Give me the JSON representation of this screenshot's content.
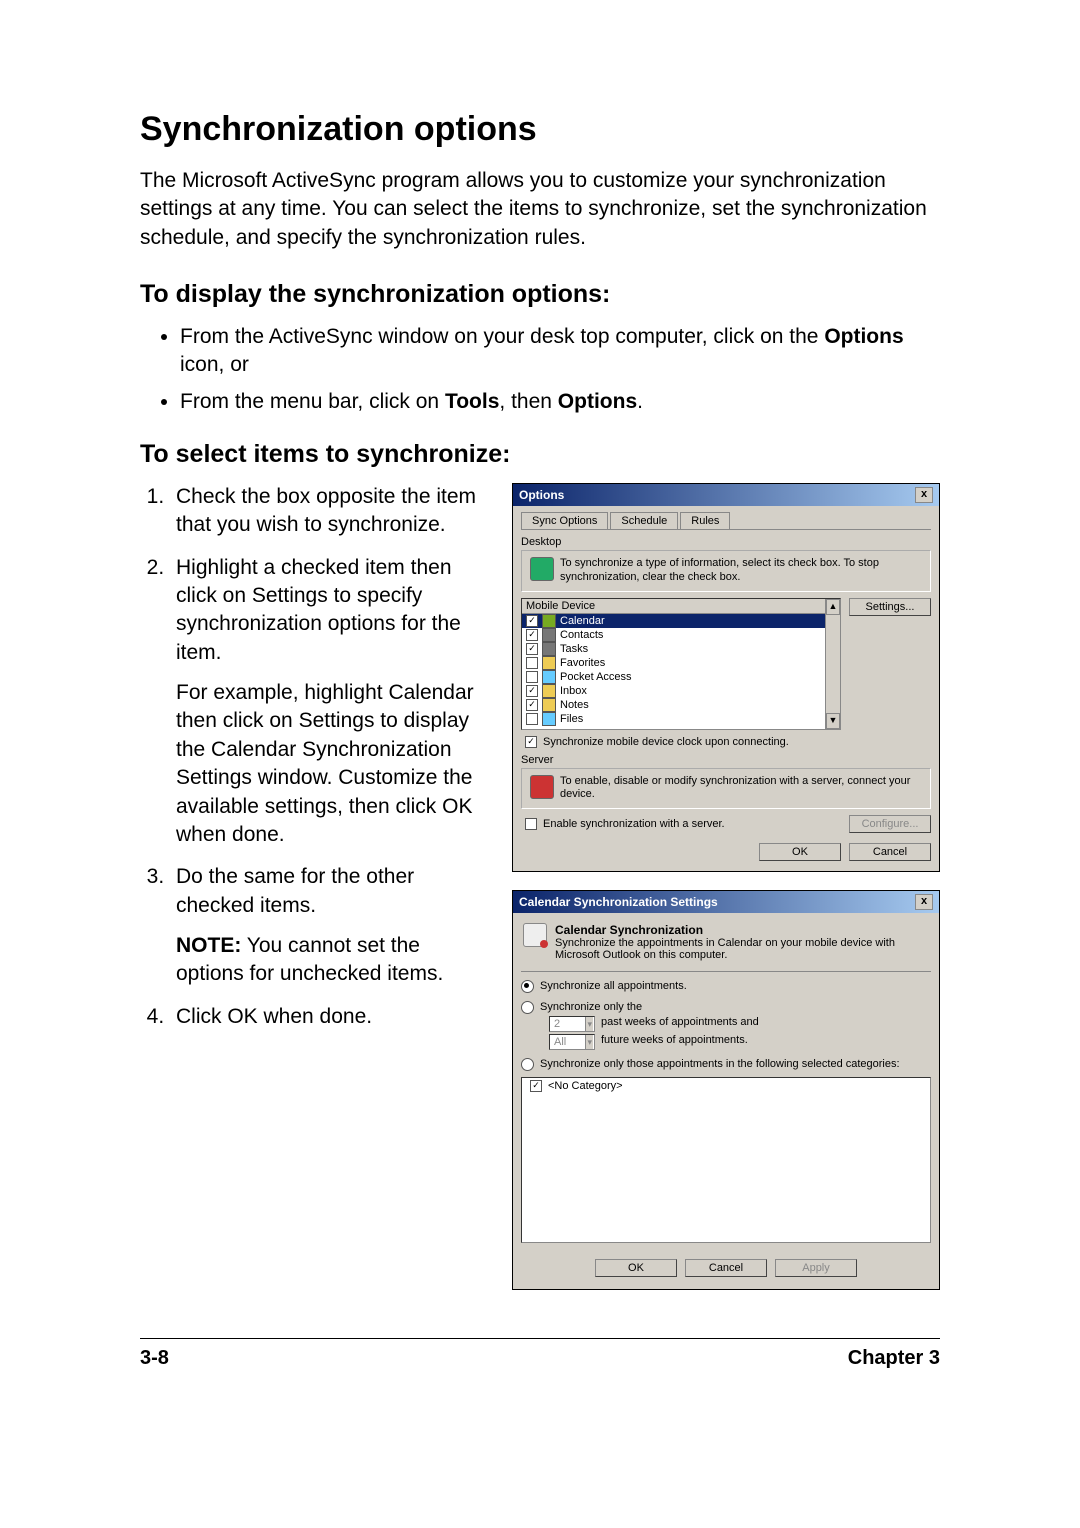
{
  "page": {
    "title": "Synchronization options",
    "intro": "The Microsoft ActiveSync program allows you to customize your synchronization settings at any time. You can select the items to synchronize, set the synchronization schedule, and specify the synchronization rules.",
    "footer_left": "3-8",
    "footer_right": "Chapter 3"
  },
  "sec_display": {
    "heading": "To display the synchronization options:",
    "b1a": "From the ActiveSync window on your desk top computer, click on the ",
    "b1b": "Options",
    "b1c": " icon, or",
    "b2a": "From the menu bar, click on ",
    "b2b": "Tools",
    "b2c": ", then ",
    "b2d": "Options",
    "b2e": "."
  },
  "sec_select": {
    "heading": "To select items to synchronize:",
    "step1": "Check the box opposite the item that you wish to synchronize.",
    "step2": "Highlight a checked item then click on Settings to specify synchronization options for the item.",
    "step2_sub": "For example, highlight Calendar then click on Settings to display the Calendar Synchronization Settings window. Customize the available settings, then click OK when done.",
    "step3": "Do the same for the other checked items.",
    "step3_note_label": "NOTE:",
    "step3_note_text": "  You cannot set the options for unchecked items.",
    "step4": "Click OK when done."
  },
  "dlg_options": {
    "title": "Options",
    "close": "x",
    "tabs": {
      "t1": "Sync Options",
      "t2": "Schedule",
      "t3": "Rules"
    },
    "desktop_label": "Desktop",
    "help_text": "To synchronize a type of information, select its check box. To stop synchronization, clear the check box.",
    "list_head": "Mobile Device",
    "settings_btn": "Settings...",
    "items": {
      "calendar": "Calendar",
      "contacts": "Contacts",
      "tasks": "Tasks",
      "favorites": "Favorites",
      "pocket_access": "Pocket Access",
      "inbox": "Inbox",
      "notes": "Notes",
      "files": "Files"
    },
    "sync_clock": "Synchronize mobile device clock upon connecting.",
    "server_label": "Server",
    "server_text": "To enable, disable or modify synchronization with a server, connect your device.",
    "enable_server": "Enable synchronization with a server.",
    "configure_btn": "Configure...",
    "ok": "OK",
    "cancel": "Cancel"
  },
  "dlg_cal": {
    "title": "Calendar Synchronization Settings",
    "close": "x",
    "head": "Calendar Synchronization",
    "desc": "Synchronize the appointments in Calendar on your mobile device with Microsoft Outlook on this computer.",
    "opt_all": "Synchronize all appointments.",
    "opt_only_the": "Synchronize only the",
    "past_val": "2",
    "past_txt": "past weeks of appointments and",
    "future_val": "All",
    "future_txt": "future weeks of appointments.",
    "opt_cats": "Synchronize only those appointments in the following selected categories:",
    "no_cat": "<No Category>",
    "ok": "OK",
    "cancel": "Cancel",
    "apply": "Apply"
  }
}
